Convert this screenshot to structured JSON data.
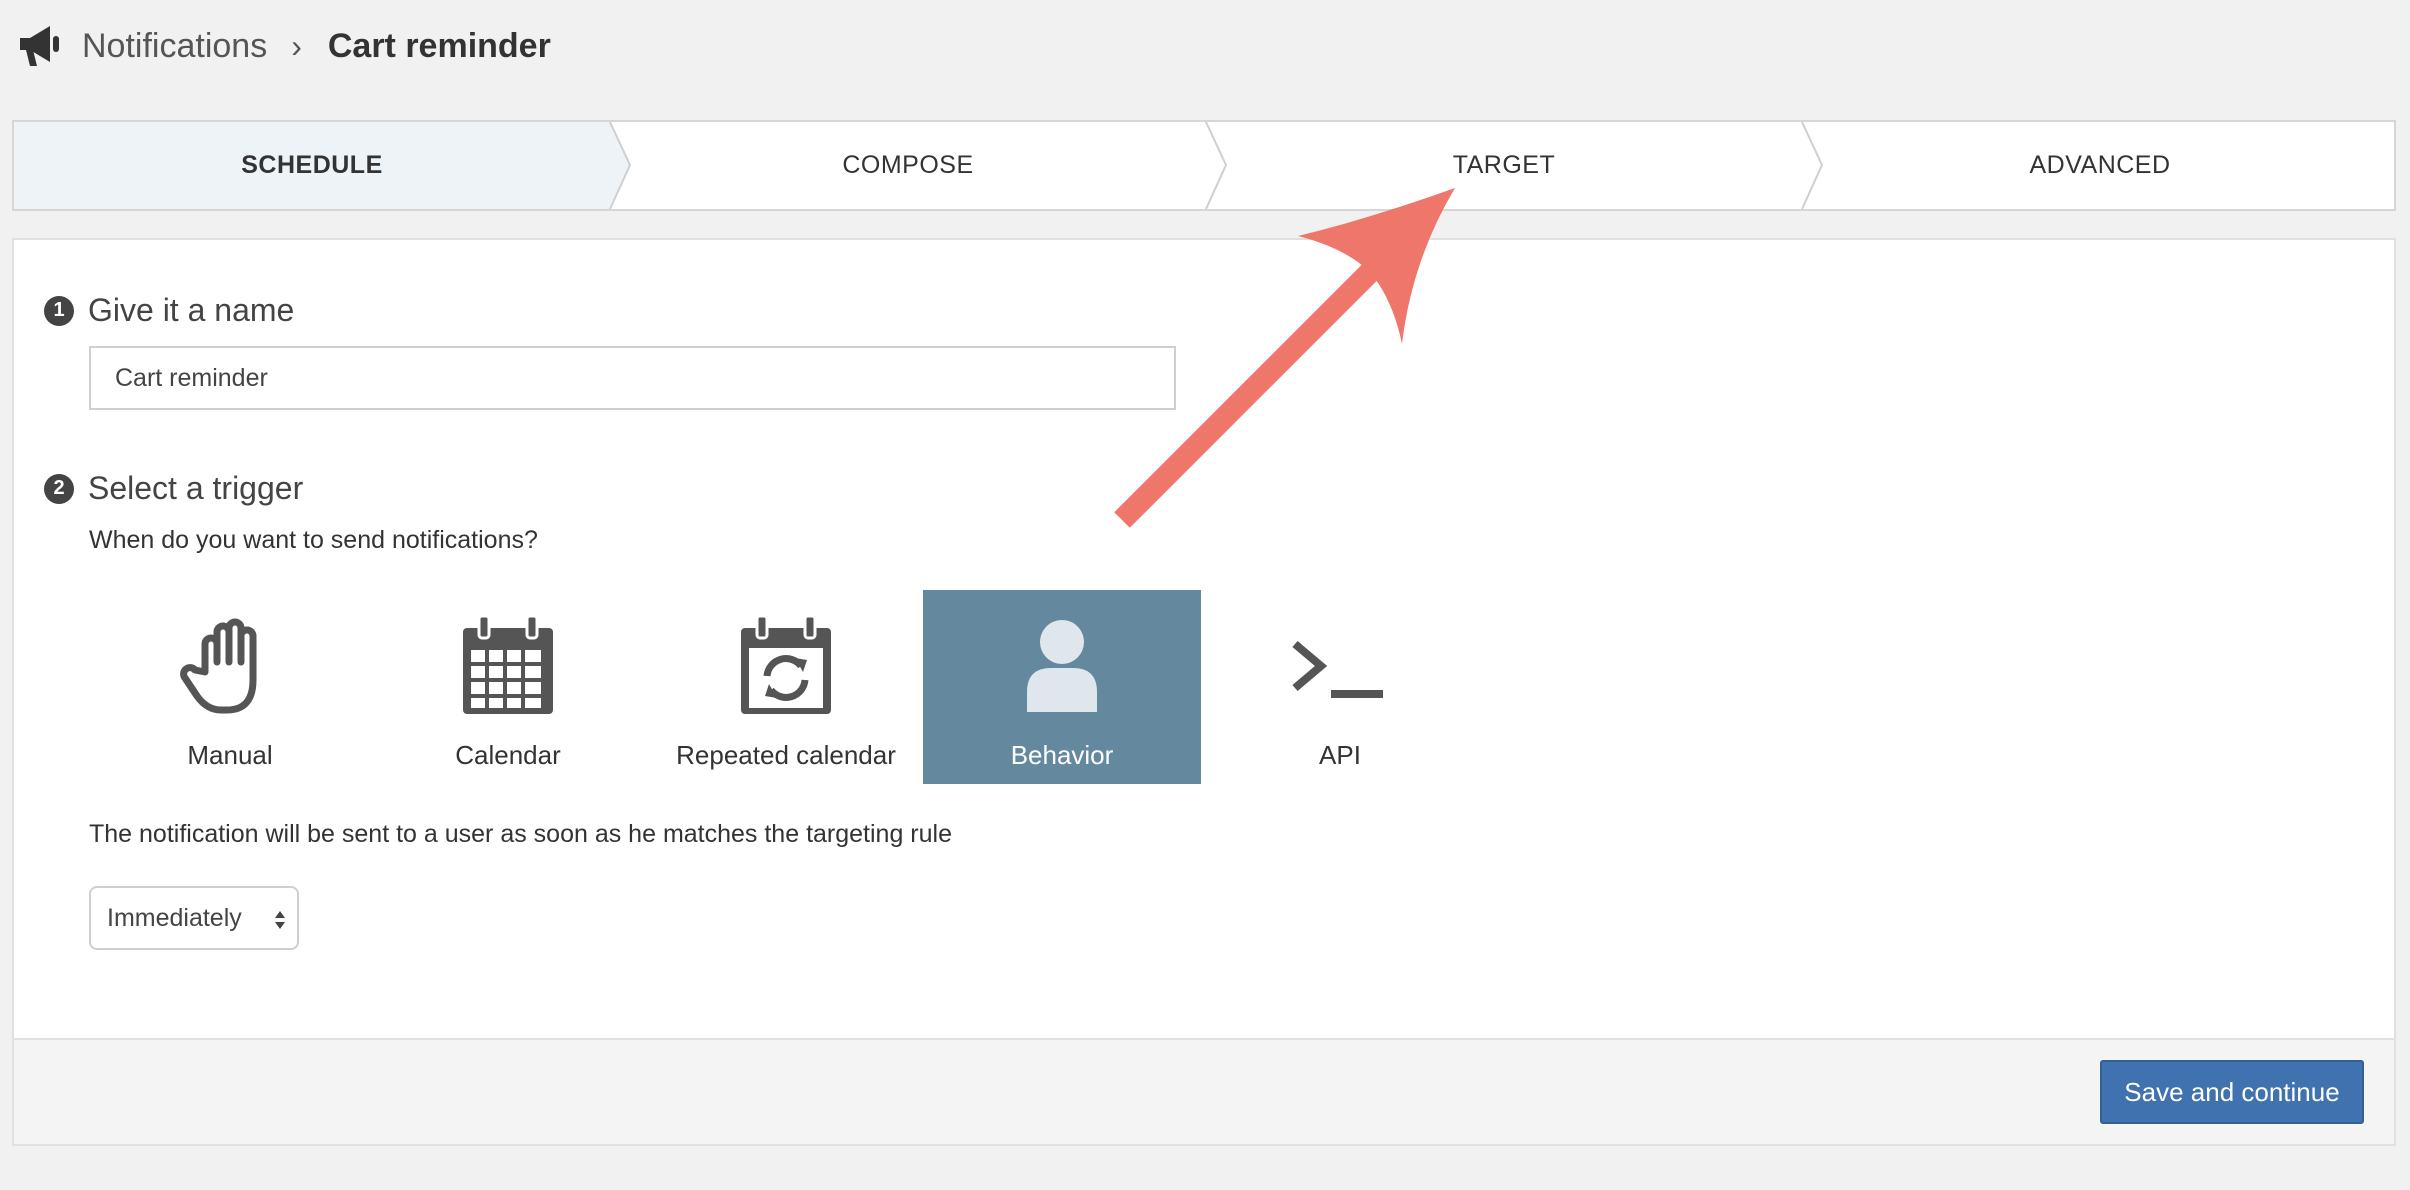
{
  "breadcrumb": {
    "icon": "megaphone-icon",
    "root": "Notifications",
    "separator": "›",
    "current": "Cart reminder"
  },
  "steps": [
    {
      "label": "SCHEDULE",
      "active": true
    },
    {
      "label": "COMPOSE",
      "active": false
    },
    {
      "label": "TARGET",
      "active": false
    },
    {
      "label": "ADVANCED",
      "active": false
    }
  ],
  "section_name": {
    "number": "1",
    "title": "Give it a name",
    "input_value": "Cart reminder"
  },
  "section_trigger": {
    "number": "2",
    "title": "Select a trigger",
    "prompt": "When do you want to send notifications?",
    "options": [
      {
        "label": "Manual",
        "icon": "hand-icon",
        "selected": false
      },
      {
        "label": "Calendar",
        "icon": "calendar-icon",
        "selected": false
      },
      {
        "label": "Repeated calendar",
        "icon": "repeat-calendar-icon",
        "selected": false
      },
      {
        "label": "Behavior",
        "icon": "user-icon",
        "selected": true
      },
      {
        "label": "API",
        "icon": "terminal-icon",
        "selected": false
      }
    ],
    "description": "The notification will be sent to a user as soon as he matches the targeting rule",
    "timing_select_value": "Immediately"
  },
  "footer": {
    "save_label": "Save and continue"
  },
  "colors": {
    "selected_trigger_bg": "#64889d",
    "primary_button": "#3f72ae",
    "annotation_arrow": "#ef766a"
  }
}
